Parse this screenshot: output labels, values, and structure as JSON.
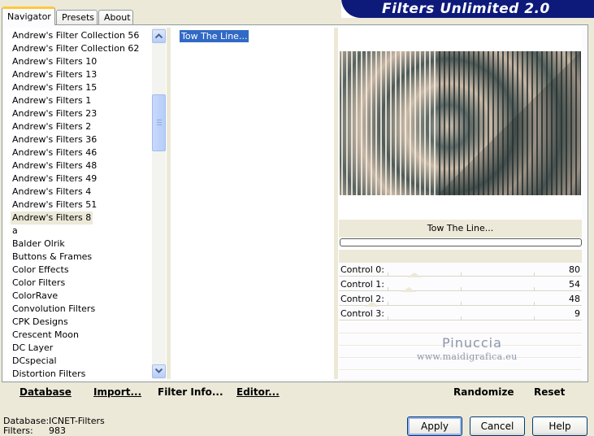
{
  "tabs": [
    {
      "label": "Navigator",
      "active": true
    },
    {
      "label": "Presets",
      "active": false
    },
    {
      "label": "About",
      "active": false
    }
  ],
  "header": {
    "title": "Filters Unlimited 2.0"
  },
  "categories": [
    "Andrew's Filter Collection 56",
    "Andrew's Filter Collection 62",
    "Andrew's Filters 10",
    "Andrew's Filters 13",
    "Andrew's Filters 15",
    "Andrew's Filters 1",
    "Andrew's Filters 23",
    "Andrew's Filters 2",
    "Andrew's Filters 36",
    "Andrew's Filters 46",
    "Andrew's Filters 48",
    "Andrew's Filters 49",
    "Andrew's Filters 4",
    "Andrew's Filters 51",
    "Andrew's Filters 8",
    "a",
    "Balder Olrik",
    "Buttons & Frames",
    "Color Effects",
    "Color Filters",
    "ColorRave",
    "Convolution Filters",
    "CPK Designs",
    "Crescent Moon",
    "DC Layer",
    "DCspecial",
    "Distortion Filters"
  ],
  "selected_category": "Andrew's Filters 8",
  "filters": [
    "Tow The Line..."
  ],
  "selected_filter": "Tow The Line...",
  "preview": {
    "filter_name": "Tow The Line...",
    "progress": 0
  },
  "controls": [
    {
      "label": "Control 0:",
      "value": "80",
      "level": 80
    },
    {
      "label": "Control 1:",
      "value": "54",
      "level": 54
    },
    {
      "label": "Control 2:",
      "value": "48",
      "level": 48
    },
    {
      "label": "Control 3:",
      "value": "9",
      "level": 9
    }
  ],
  "watermark": {
    "name": "Pinuccia",
    "url": "www.maidigrafica.eu"
  },
  "toolbar": {
    "database": "Database",
    "import": "Import...",
    "filter_info": "Filter Info...",
    "editor": "Editor...",
    "randomize": "Randomize",
    "reset": "Reset"
  },
  "status": {
    "database_label": "Database:",
    "database_value": "ICNET-Filters",
    "filters_label": "Filters:",
    "filters_value": "983"
  },
  "buttons": {
    "apply": "Apply",
    "cancel": "Cancel",
    "help": "Help"
  },
  "colors": {
    "selection": "#316ac5",
    "banner": "#0e1a7a",
    "face": "#ece9d8"
  }
}
